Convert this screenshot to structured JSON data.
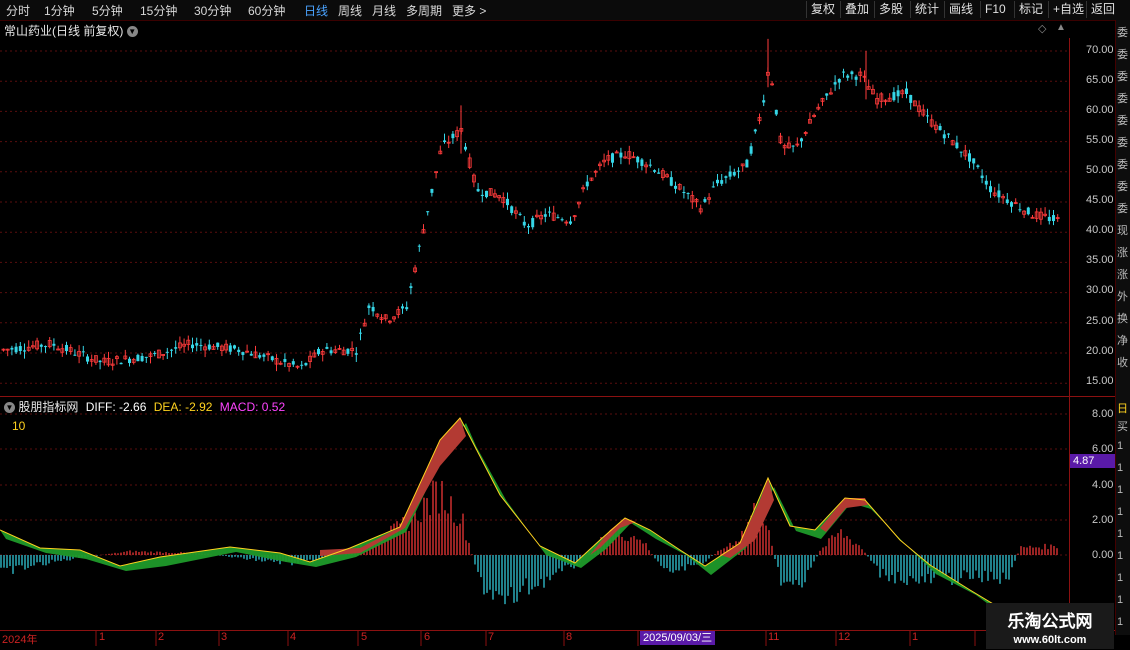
{
  "toolbar": {
    "periods": [
      "分时",
      "1分钟",
      "5分钟",
      "15分钟",
      "30分钟",
      "60分钟",
      "日线",
      "周线",
      "月线",
      "多周期",
      "更多 >"
    ],
    "active_period": "日线",
    "right_buttons": [
      "复权",
      "叠加",
      "多股",
      "统计",
      "画线",
      "F10",
      "标记",
      "+自选",
      "返回"
    ]
  },
  "main_title": "常山药业(日线 前复权)",
  "price_axis": [
    "70.00",
    "65.00",
    "60.00",
    "55.00",
    "50.00",
    "45.00",
    "40.00",
    "35.00",
    "30.00",
    "25.00",
    "20.00",
    "15.00"
  ],
  "indicator": {
    "name": "股朋指标网",
    "diff": "DIFF: -2.66",
    "dea": "DEA: -2.92",
    "macd": "MACD: 0.52",
    "sub_label": "10",
    "axis": [
      "8.00",
      "6.00",
      "4.00",
      "2.00",
      "0.00"
    ],
    "current_value": "4.87"
  },
  "side_chars": [
    "委",
    "委",
    "委",
    "委",
    "委",
    "委",
    "委",
    "委",
    "委",
    "现",
    "涨",
    "涨",
    "外",
    "换",
    "净",
    "收"
  ],
  "indicator_side_chars": [
    "日",
    "买",
    "1",
    "1",
    "1",
    "1",
    "1",
    "1",
    "1",
    "1",
    "1",
    "1"
  ],
  "date_axis": {
    "labels": [
      "2024年",
      "1",
      "2",
      "3",
      "4",
      "5",
      "6",
      "7",
      "8",
      "11",
      "12",
      "1"
    ],
    "cursor": "2025/09/03/三"
  },
  "watermark": {
    "line1": "乐淘公式网",
    "line2": "www.60lt.com"
  },
  "colors": {
    "up": "#ff3b3b",
    "down": "#36d6e7",
    "accent": "#4aa3ff",
    "diff": "#ffffff",
    "dea": "#ffd21f",
    "macd": "#ff44ff"
  }
}
